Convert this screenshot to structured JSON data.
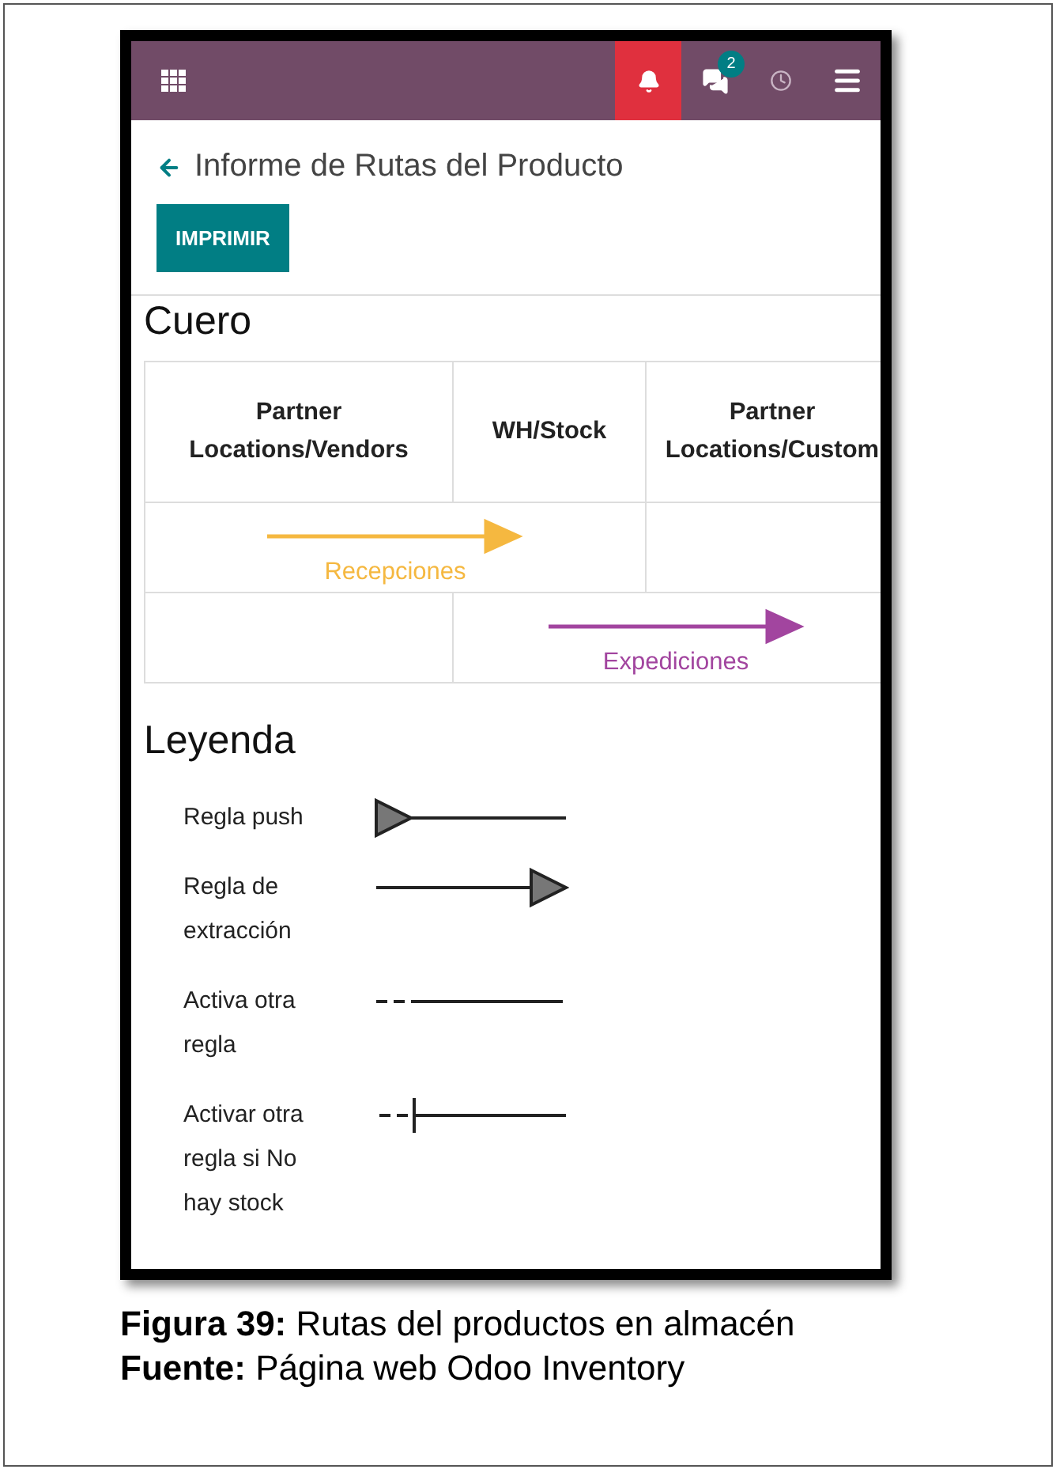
{
  "navbar": {
    "message_count": "2"
  },
  "header": {
    "title": "Informe de Rutas del Producto",
    "print_button": "IMPRIMIR"
  },
  "product": "Cuero",
  "table": {
    "columns": [
      "Partner Locations/Vendors",
      "WH/Stock",
      "Partner Locations/Custom"
    ],
    "routes": [
      {
        "label": "Recepciones",
        "color": "#f5b840",
        "kind": "incoming"
      },
      {
        "label": "Expediciones",
        "color": "#a2459f",
        "kind": "outgoing"
      }
    ]
  },
  "legend": {
    "title": "Leyenda",
    "items": [
      {
        "label": "Regla push",
        "kind": "push"
      },
      {
        "label": "Regla de extracción",
        "kind": "pull"
      },
      {
        "label": "Activa otra regla",
        "kind": "chain"
      },
      {
        "label": "Activar otra regla si No hay stock",
        "kind": "mts"
      }
    ]
  },
  "caption": [
    "**Figura 39:** Rutas del productos en almacén",
    "**Fuente:** Página web Odoo Inventory"
  ]
}
